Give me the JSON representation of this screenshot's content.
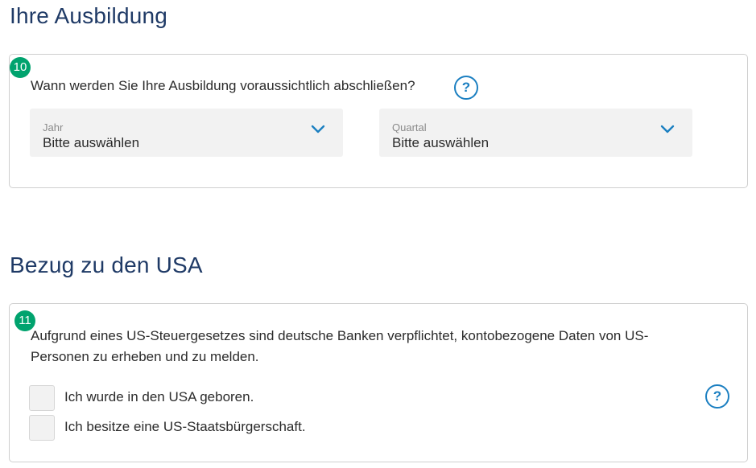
{
  "education": {
    "title": "Ihre Ausbildung",
    "step": "10",
    "question": "Wann werden Sie Ihre Ausbildung voraussichtlich abschließen?",
    "help_symbol": "?",
    "year_select": {
      "label": "Jahr",
      "value": "Bitte auswählen"
    },
    "quarter_select": {
      "label": "Quartal",
      "value": "Bitte auswählen"
    }
  },
  "usa": {
    "title": "Bezug zu den USA",
    "step": "11",
    "question": "Aufgrund eines US-Steuergesetzes sind deutsche Banken verpflichtet, kontobezogene Daten von US-Personen zu erheben und zu melden.",
    "help_symbol": "?",
    "options": [
      {
        "label": "Ich wurde in den USA geboren.",
        "checked": false
      },
      {
        "label": "Ich besitze eine US-Staatsbürgerschaft.",
        "checked": false
      }
    ]
  },
  "colors": {
    "heading": "#1f3a66",
    "accent": "#1b7fc1",
    "step_badge": "#00a36e"
  },
  "icons": {
    "help": "question-circle-icon",
    "dropdown": "chevron-down-icon"
  }
}
